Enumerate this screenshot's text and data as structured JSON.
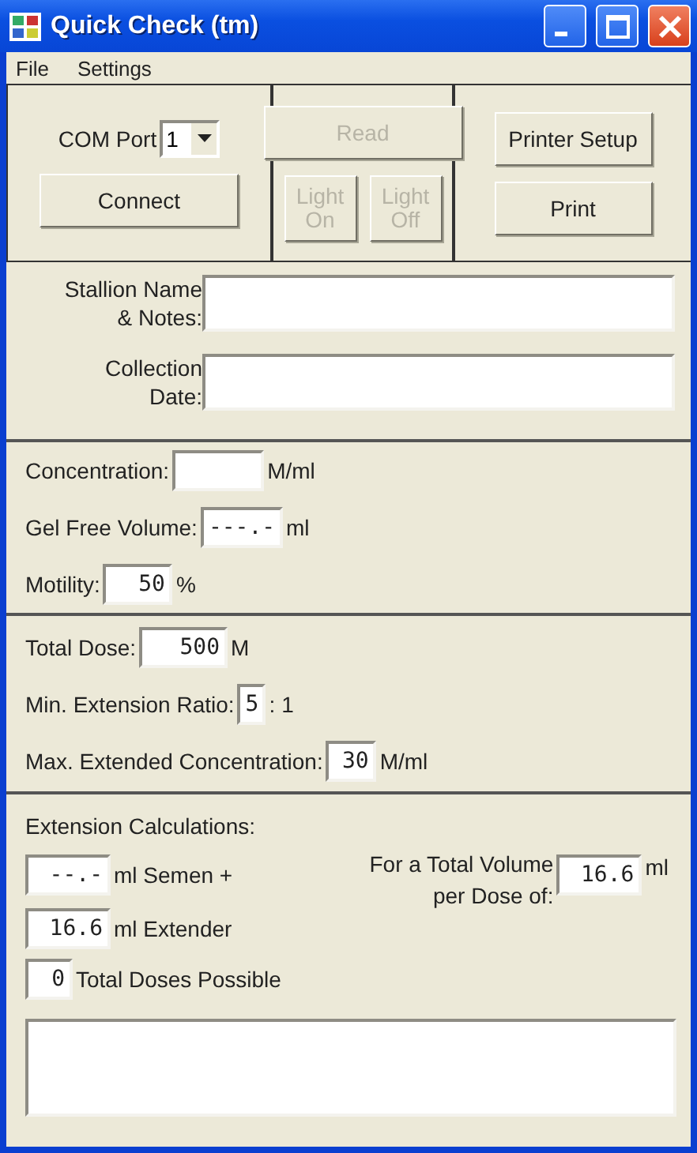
{
  "window": {
    "title": "Quick Check (tm)"
  },
  "menu": [
    {
      "label": "File"
    },
    {
      "label": "Settings"
    }
  ],
  "toolbar": {
    "groups": [
      {
        "items": [
          {
            "kind": "combo",
            "label": "COM Port",
            "value": "1"
          },
          {
            "kind": "button",
            "label": "Connect",
            "disabled": false
          }
        ]
      },
      {
        "items": [
          {
            "kind": "button",
            "label": "Read",
            "disabled": true
          },
          {
            "kind": "mini_button",
            "label": "Light On",
            "disabled": true
          },
          {
            "kind": "mini_button",
            "label": "Light Off",
            "disabled": true
          }
        ]
      },
      {
        "items": [
          {
            "kind": "button",
            "label": "Printer Setup",
            "disabled": false
          },
          {
            "kind": "button",
            "label": "Print",
            "disabled": false
          }
        ]
      }
    ]
  },
  "notes": [
    {
      "label": "Stallion Name & Notes:"
    },
    {
      "label": "Collection Date:"
    }
  ],
  "sample": [
    {
      "label": "Concentration:",
      "unit": "M/ml"
    },
    {
      "label": "Gel Free Volume:",
      "value": "---.-",
      "unit": "ml"
    },
    {
      "label": "Motility:",
      "value": "50",
      "unit": "%"
    }
  ],
  "dose": [
    {
      "label": "Total Dose:",
      "value": "500",
      "unit": "M"
    },
    {
      "label": "Min. Extension Ratio:",
      "value": "5",
      "unit": ": 1"
    },
    {
      "label": "Max. Extended Concentration:",
      "value": "30",
      "unit": "M/ml"
    }
  ],
  "extension": {
    "heading": "Extension Calculations:",
    "semen": {
      "value": "--.-",
      "unit": "ml Semen +"
    },
    "extender": {
      "value": "16.6",
      "unit": "ml Extender"
    },
    "volume": {
      "label": "For a Total Volume per Dose of:",
      "value": "16.6",
      "unit": "ml"
    },
    "doses": {
      "value": "0",
      "unit": "Total Doses Possible"
    }
  }
}
